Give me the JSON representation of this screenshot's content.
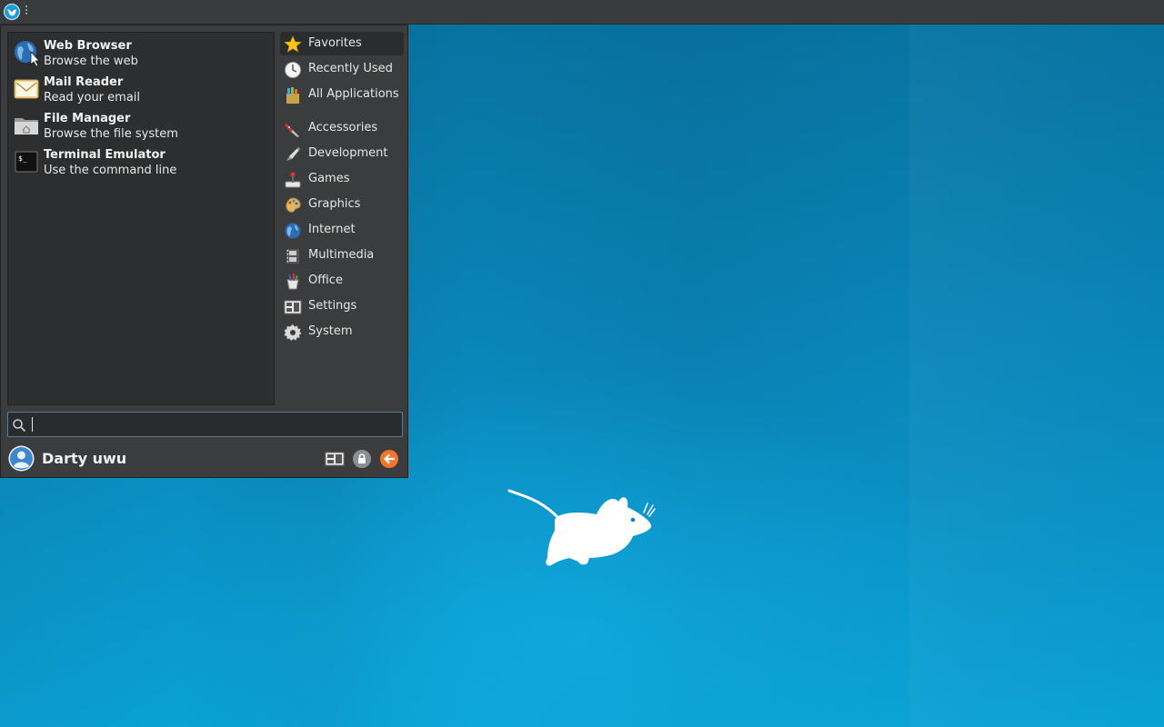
{
  "panel": {
    "menu_button_icon": "xfce-whisker-icon",
    "handle_icon": "panel-handle-icon"
  },
  "favorites": [
    {
      "name": "Web Browser",
      "description": "Browse the web",
      "icon": "globe-icon"
    },
    {
      "name": "Mail Reader",
      "description": "Read your email",
      "icon": "envelope-icon"
    },
    {
      "name": "File Manager",
      "description": "Browse the file system",
      "icon": "folder-icon"
    },
    {
      "name": "Terminal Emulator",
      "description": "Use the command line",
      "icon": "terminal-icon"
    }
  ],
  "categories": [
    {
      "label": "Favorites",
      "icon": "star-icon",
      "active": true
    },
    {
      "label": "Recently Used",
      "icon": "clock-icon"
    },
    {
      "label": "All Applications",
      "icon": "applications-icon"
    },
    {
      "label": "Accessories",
      "icon": "accessories-icon"
    },
    {
      "label": "Development",
      "icon": "development-icon"
    },
    {
      "label": "Games",
      "icon": "joystick-icon"
    },
    {
      "label": "Graphics",
      "icon": "palette-icon"
    },
    {
      "label": "Internet",
      "icon": "globe-icon"
    },
    {
      "label": "Multimedia",
      "icon": "film-icon"
    },
    {
      "label": "Office",
      "icon": "office-icon"
    },
    {
      "label": "Settings",
      "icon": "settings-icon"
    },
    {
      "label": "System",
      "icon": "gear-icon"
    }
  ],
  "search": {
    "value": "",
    "placeholder": ""
  },
  "user": {
    "name": "Darty uwu"
  },
  "actions": {
    "settings_icon": "settings-manager-icon",
    "lock_icon": "lock-icon",
    "logout_icon": "logout-icon"
  },
  "colors": {
    "desktop": "#0a88bc",
    "panel": "#3a3b3c",
    "menu": "#3b3c3d",
    "list": "#2d2e2f",
    "logout": "#f0762e"
  }
}
